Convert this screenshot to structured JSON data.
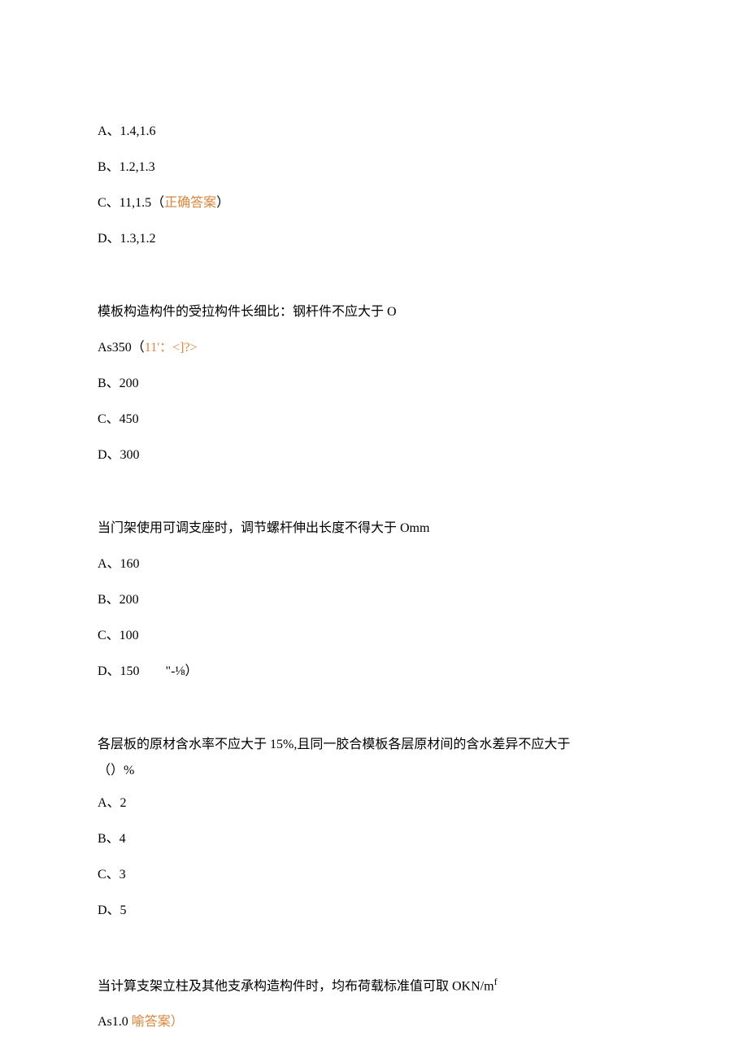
{
  "q1": {
    "optA": "A、1.4,1.6",
    "optB": "B、1.2,1.3",
    "optC_prefix": "C、11,1.5（",
    "optC_correct": "正确答案",
    "optC_suffix": "）",
    "optD": "D、1.3,1.2"
  },
  "q2": {
    "text": "模板构造构件的受拉构件长细比：钢杆件不应大于 O",
    "optA_prefix": "As350（",
    "optA_correct": "11'：<]?>",
    "optB": "B、200",
    "optC": "C、450",
    "optD": "D、300"
  },
  "q3": {
    "text": "当门架使用可调支座时，调节螺杆伸出长度不得大于 Omm",
    "optA": "A、160",
    "optB": "B、200",
    "optC": "C、100",
    "optD_prefix": "D、150  \"-⅛",
    "optD_suffix": "）"
  },
  "q4": {
    "text1": "各层板的原材含水率不应大于 15%,且同一胶合模板各层原材间的含水差异不应大于",
    "text2": "（）%",
    "optA": "A、2",
    "optB": "B、4",
    "optC": "C、3",
    "optD": "D、5"
  },
  "q5": {
    "text": "当计算支架立柱及其他支承构造构件时，均布荷载标准值可取 OKN/m",
    "text_sup": "f",
    "optA_prefix": "As1.0 ",
    "optA_correct": "喻答案）"
  }
}
